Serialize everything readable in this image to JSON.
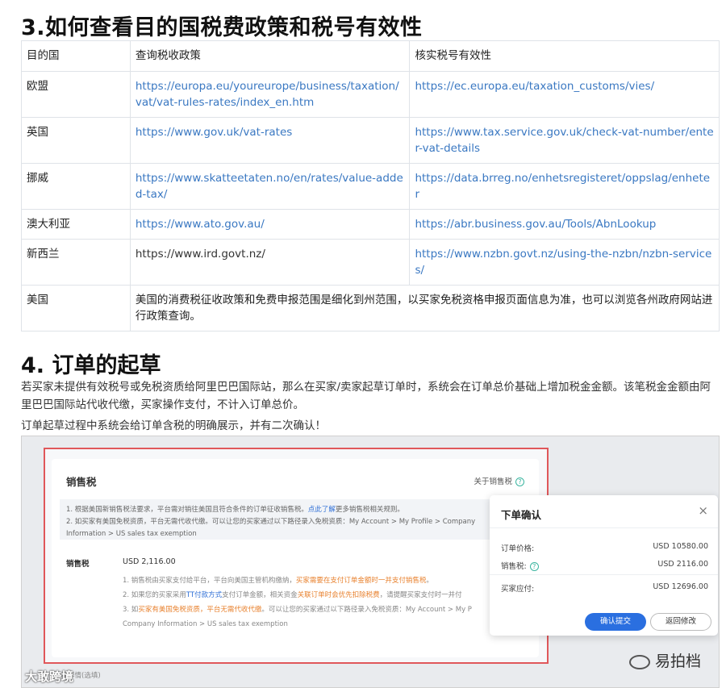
{
  "section3": {
    "title": "3.如何查看目的国税费政策和税号有效性",
    "headers": [
      "目的国",
      "查询税收政策",
      "核实税号有效性"
    ],
    "rows": [
      {
        "country": "欧盟",
        "policy": "https://europa.eu/youreurope/business/taxation/vat/vat-rules-rates/index_en.htm",
        "verify": "https://ec.europa.eu/taxation_customs/vies/"
      },
      {
        "country": "英国",
        "policy": "https://www.gov.uk/vat-rates",
        "verify": "https://www.tax.service.gov.uk/check-vat-number/enter-vat-details"
      },
      {
        "country": "挪威",
        "policy": "https://www.skatteetaten.no/en/rates/value-added-tax/",
        "verify": "https://data.brreg.no/enhetsregisteret/oppslag/enheter"
      },
      {
        "country": "澳大利亚",
        "policy": "https://www.ato.gov.au/",
        "verify": "https://abr.business.gov.au/Tools/AbnLookup"
      },
      {
        "country": "新西兰",
        "policy": "https://www.ird.govt.nz/",
        "verify": "https://www.nzbn.govt.nz/using-the-nzbn/nzbn-services/"
      },
      {
        "country": "美国",
        "note": "美国的消费税征收政策和免费申报范围是细化到州范围，以买家免税资格申报页面信息为准，也可以浏览各州政府网站进行政策查询。"
      }
    ]
  },
  "section4": {
    "title": "4. 订单的起草",
    "para1": "若买家未提供有效税号或免税资质给阿里巴巴国际站，那么在买家/卖家起草订单时，系统会在订单总价基础上增加税金金额。该笔税金金额由阿里巴巴国际站代收代缴，买家操作支付，不计入订单总价。",
    "para2": "订单起草过程中系统会给订单含税的明确展示，并有二次确认！"
  },
  "screenshot": {
    "card_title": "销售税",
    "about_link": "关于销售税",
    "notice_1a": "1. 根据美国新销售税法要求，平台需对销往美国且符合条件的订单征收销售税。",
    "notice_1_link": "点此了解",
    "notice_1b": "更多销售税相关规则。",
    "notice_2": "2. 如买家有美国免税资质，平台无需代收代缴。可以让您的买家通过以下路径录入免税资质：My Account > My Profile > Company",
    "notice_3": "Information > US sales tax exemption",
    "tax_label": "销售税",
    "tax_value": "USD 2,116.00",
    "b1a": "1. 销售税由买家支付给平台，平台向美国主管机构缴纳，",
    "b1b": "买家需要在支付订单金额时一并支付销售税",
    "b1c": "。",
    "b2a": "2. 如果您的买家采用",
    "b2b": "TT付款方式",
    "b2c": "支付订单金额，相关资金",
    "b2d": "关联订单时会优先扣除税费",
    "b2e": "，请提醒买家支付时一并付",
    "b3a": "3. 如",
    "b3b": "买家有美国免税资质，平台无需代收代缴",
    "b3c": "。可以让您的买家通过以下路径录入免税资质：My Account > My P",
    "b4": "Company Information > US sales tax exemption",
    "cut_text": "订单详情(选填)",
    "modal": {
      "title": "下单确认",
      "close": "×",
      "price_label": "订单价格:",
      "price_value": "USD 10580.00",
      "tax_label": "销售税:",
      "tax_value": "USD 2116.00",
      "payable_label": "买家应付:",
      "payable_value": "USD 12696.00",
      "confirm": "确认提交",
      "back": "返回修改"
    }
  },
  "watermarks": {
    "right": "易拍档",
    "left": "大敢跨境"
  },
  "colors": {
    "link": "#3a78c2",
    "highlight_border": "#e0575a",
    "primary_button": "#2a6fe0",
    "orange_text": "#e8822f"
  }
}
